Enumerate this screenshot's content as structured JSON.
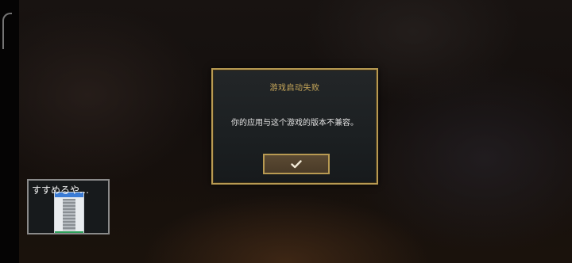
{
  "dialog": {
    "title": "游戏启动失败",
    "message": "你的应用与这个游戏的版本不兼容。",
    "confirm_icon": "checkmark-icon"
  },
  "overlay": {
    "label": "すすめるや…"
  },
  "colors": {
    "accent_gold": "#b89a52",
    "title_gold": "#c8a85a",
    "button_brown": "#5b4a33",
    "dialog_bg": "#1f2325"
  }
}
